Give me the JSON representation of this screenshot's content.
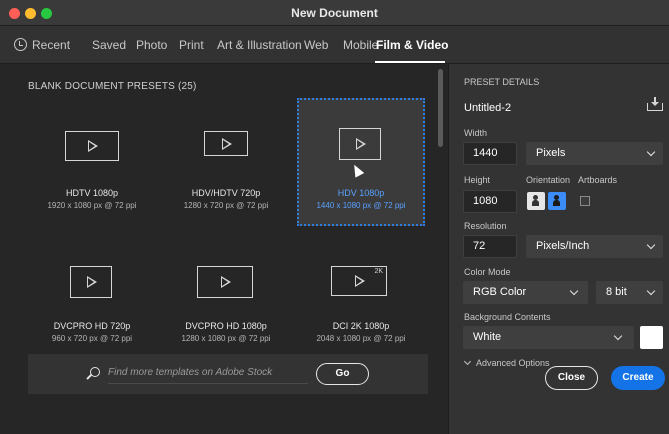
{
  "window": {
    "title": "New Document"
  },
  "tabs": [
    {
      "label": "Recent",
      "icon": "clock-icon"
    },
    {
      "label": "Saved"
    },
    {
      "label": "Photo"
    },
    {
      "label": "Print"
    },
    {
      "label": "Art & Illustration"
    },
    {
      "label": "Web"
    },
    {
      "label": "Mobile"
    },
    {
      "label": "Film & Video",
      "active": true
    }
  ],
  "presets": {
    "heading": "BLANK DOCUMENT PRESETS (25)",
    "items": [
      {
        "name": "HDTV 1080p",
        "dims": "1920 x 1080 px @ 72 ppi",
        "selected": false
      },
      {
        "name": "HDV/HDTV 720p",
        "dims": "1280 x 720 px @ 72 ppi",
        "selected": false
      },
      {
        "name": "HDV 1080p",
        "dims": "1440 x 1080 px @ 72 ppi",
        "selected": true
      },
      {
        "name": "DVCPRO HD 720p",
        "dims": "960 x 720 px @ 72 ppi",
        "selected": false
      },
      {
        "name": "DVCPRO HD 1080p",
        "dims": "1280 x 1080 px @ 72 ppi",
        "selected": false
      },
      {
        "name": "DCI 2K 1080p",
        "dims": "2048 x 1080 px @ 72 ppi",
        "selected": false,
        "badge": "2K"
      }
    ]
  },
  "search": {
    "placeholder": "Find more templates on Adobe Stock",
    "go_label": "Go"
  },
  "details": {
    "heading": "PRESET DETAILS",
    "doc_name": "Untitled-2",
    "width_label": "Width",
    "width_value": "1440",
    "width_unit": "Pixels",
    "height_label": "Height",
    "height_value": "1080",
    "orientation_label": "Orientation",
    "artboards_label": "Artboards",
    "artboards_checked": false,
    "resolution_label": "Resolution",
    "resolution_value": "72",
    "resolution_unit": "Pixels/Inch",
    "color_mode_label": "Color Mode",
    "color_mode_value": "RGB Color",
    "bit_depth_value": "8 bit",
    "background_label": "Background Contents",
    "background_value": "White",
    "background_swatch": "#ffffff",
    "advanced_label": "Advanced Options",
    "close_label": "Close",
    "create_label": "Create"
  },
  "colors": {
    "accent": "#1473e6",
    "selected_text": "#5aa0ff",
    "panel_bg": "#262626",
    "details_bg": "#333333"
  }
}
